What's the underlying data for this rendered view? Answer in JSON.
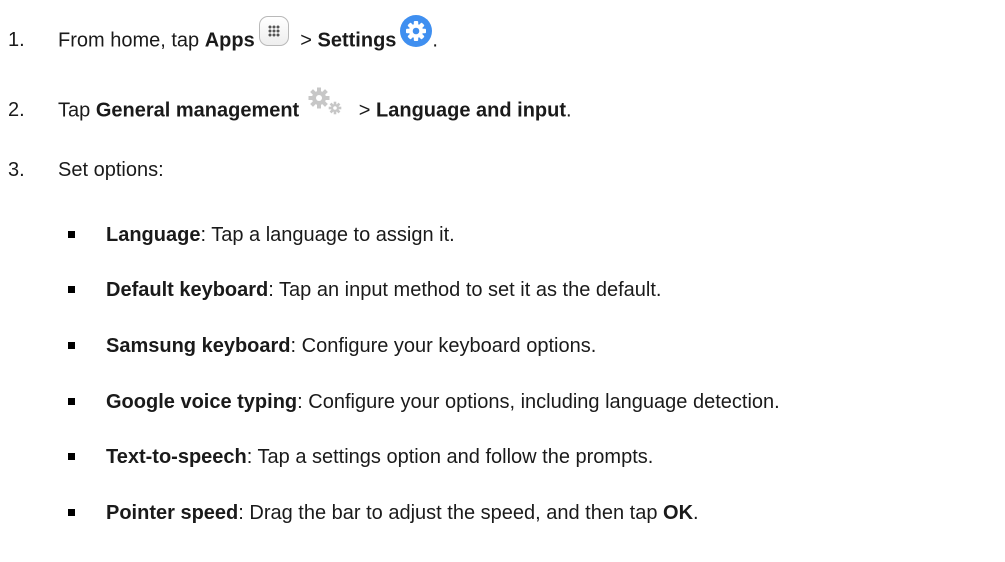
{
  "steps": [
    {
      "number": "1.",
      "prefix": "From home, tap ",
      "bold1": "Apps",
      "icon1": "apps-grid-icon",
      "sep": " > ",
      "bold2": "Settings",
      "icon2": "settings-gear-icon",
      "suffix": "."
    },
    {
      "number": "2.",
      "prefix": "Tap ",
      "bold1": "General management",
      "icon1": "general-management-gears-icon",
      "sep": " > ",
      "bold2": "Language and input",
      "suffix": "."
    },
    {
      "number": "3.",
      "text": "Set options:"
    }
  ],
  "options": [
    {
      "term": "Language",
      "desc": ": Tap a language to assign it."
    },
    {
      "term": "Default keyboard",
      "desc": ": Tap an input method to set it as the default."
    },
    {
      "term": "Samsung keyboard",
      "desc": ": Configure your keyboard options."
    },
    {
      "term": "Google voice typing",
      "desc": ": Configure your options, including language detection."
    },
    {
      "term": "Text-to-speech",
      "desc": ": Tap a settings option and follow the prompts."
    },
    {
      "term": "Pointer speed",
      "desc": ": Drag the bar to adjust the speed, and then tap ",
      "term2": "OK",
      "end": "."
    }
  ],
  "colors": {
    "text": "#1a1a1a",
    "settings_icon": "#3f8ff0",
    "gear_gray": "#c7c7c7"
  }
}
